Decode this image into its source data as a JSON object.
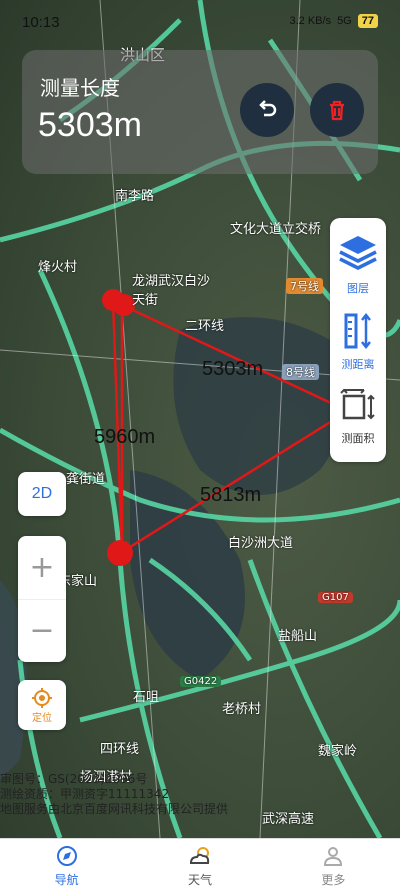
{
  "status": {
    "time": "10:13",
    "signal": "5G",
    "speed": "3.2 KB/s",
    "battery": "77"
  },
  "panel": {
    "title": "测量长度",
    "value": "5303m"
  },
  "tools": [
    {
      "label": "图层",
      "icon": "layers-icon"
    },
    {
      "label": "测距离",
      "icon": "measure-distance-icon"
    },
    {
      "label": "测面积",
      "icon": "measure-area-icon"
    }
  ],
  "controls": {
    "mode": "2D",
    "zoom_in": "+",
    "zoom_out": "−",
    "locate": "定位"
  },
  "map_labels": [
    "洪山区",
    "南李路",
    "文化大道立交桥",
    "烽火村",
    "龙湖武汉白沙天街",
    "7号线",
    "8号线",
    "二环线",
    "白沙洲大道",
    "G107",
    "盐船山",
    "G0422",
    "石咀",
    "老桥村",
    "四环线",
    "扬泗港村",
    "魏家岭",
    "龚街道",
    "东家山",
    "武深高速"
  ],
  "distances": [
    "5303m",
    "5960m",
    "5813m"
  ],
  "copyright": [
    "审图号：GS(2023)2096号",
    "测绘资质：甲测资字11111342",
    "地图服务由北京百度网讯科技有限公司提供"
  ],
  "nav": [
    {
      "label": "导航",
      "icon": "navigation-icon",
      "active": true
    },
    {
      "label": "天气",
      "icon": "weather-icon",
      "active": false
    },
    {
      "label": "更多",
      "icon": "more-icon",
      "active": false
    }
  ],
  "colors": {
    "accent": "#2d6fe0",
    "measure_line": "#e01818",
    "road": "#57d6a4"
  }
}
